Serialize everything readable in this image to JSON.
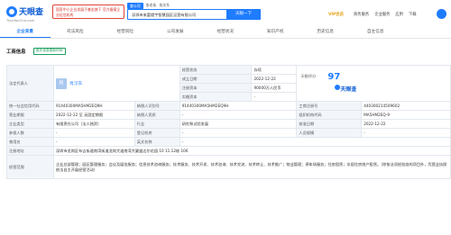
{
  "header": {
    "logo_text": "天眼查",
    "logo_url": "TianYanCha.com",
    "promo": "国家中小企业发展子基金旗下 官方备案企业征信机构",
    "search_tabs": [
      "查公司",
      "查老板",
      "查关系"
    ],
    "search_value": "深圳市来富楼宇智慧园区运营有限公司",
    "search_button": "天眼一下",
    "vip": "VIP会员",
    "nav": [
      "商务服务",
      "企业服务",
      "应用",
      "下载"
    ]
  },
  "tabs": [
    "企业背景",
    "司法风险",
    "经营风险",
    "公司发展",
    "经营状况",
    "知识产权",
    "历史信息",
    "自主信息"
  ],
  "section": {
    "title": "工商信息",
    "badge": "股东信息更新时间"
  },
  "info": {
    "rep_label": "法定代表人",
    "rep_avatar": "肖",
    "rep_name": "肖汉东",
    "status_label": "经营状态",
    "status_value": "存续",
    "found_label": "成立日期",
    "found_value": "2022-12-22",
    "capital_label": "注册资本",
    "capital_value": "90000万人民币",
    "paid_label": "实缴资本",
    "paid_value": "-",
    "score_label": "天眼评分",
    "score_value": "97",
    "brand": "天眼查",
    "credit_label": "统一社会信用代码",
    "credit_value": "91440300MA5HM2EQ9H",
    "taxid_label": "纳税人识别号",
    "taxid_value": "91440300MA5HM2EQ9H",
    "reg_label": "工商注册号",
    "reg_value": "440300214509602",
    "term_label": "营业期限",
    "term_value": "2022-12-22 至 无固定期限",
    "qual_label": "纳税人资质",
    "qual_value": "-",
    "org_label": "组织机构代码",
    "org_value": "MA5HM2EQ-9",
    "type_label": "企业类型",
    "type_value": "有限责任公司（法人独资）",
    "industry_label": "行业",
    "industry_value": "研究和试验发展",
    "approve_label": "核准日期",
    "approve_value": "2022-12-22",
    "insured_label": "参保人数",
    "insured_value": "-",
    "reg_org_label": "登记机关",
    "reg_org_value": "-",
    "staff_label": "人员规模",
    "staff_value": "-",
    "formername_label": "曾用名",
    "formername_value": "-",
    "en_label": "英文名称",
    "en_value": "-",
    "addr_label": "注册地址",
    "addr_value": "深圳市龙岗区布吉街道南湾街道龙岗大道南湾大厦盛达尔花园 10 11.12栋 106",
    "scope_label": "经营范围",
    "scope_value": "企业总部管理；园区管理服务；会议及展览服务；信息技术咨询服务；技术服务、技术开发、技术咨询、技术交流、技术转让、技术推广；物业管理；停车场服务；住房租赁；非居住房地产租赁。（除依法须经批准的项目外，凭营业执照依法自主开展经营活动）"
  }
}
